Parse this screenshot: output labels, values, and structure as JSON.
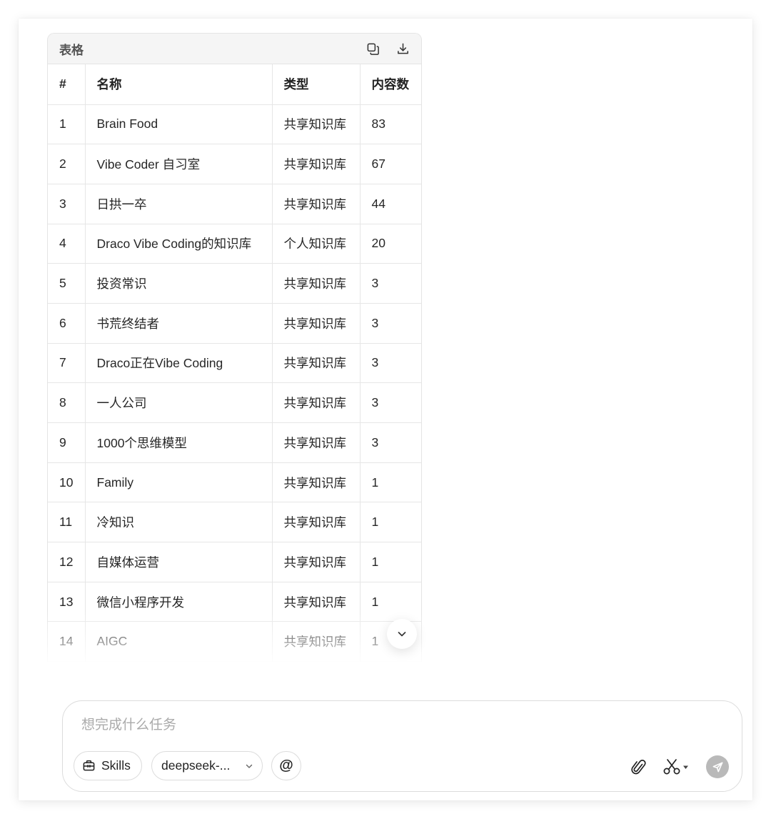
{
  "table_card": {
    "title": "表格",
    "copy_icon": "copy-icon",
    "download_icon": "download-icon",
    "columns": [
      "#",
      "名称",
      "类型",
      "内容数"
    ],
    "rows": [
      [
        "1",
        "Brain Food",
        "共享知识库",
        "83"
      ],
      [
        "2",
        "Vibe Coder 自习室",
        "共享知识库",
        "67"
      ],
      [
        "3",
        "日拱一卒",
        "共享知识库",
        "44"
      ],
      [
        "4",
        "Draco Vibe Coding的知识库",
        "个人知识库",
        "20"
      ],
      [
        "5",
        "投资常识",
        "共享知识库",
        "3"
      ],
      [
        "6",
        "书荒终结者",
        "共享知识库",
        "3"
      ],
      [
        "7",
        "Draco正在Vibe Coding",
        "共享知识库",
        "3"
      ],
      [
        "8",
        "一人公司",
        "共享知识库",
        "3"
      ],
      [
        "9",
        "1000个思维模型",
        "共享知识库",
        "3"
      ],
      [
        "10",
        "Family",
        "共享知识库",
        "1"
      ],
      [
        "11",
        "冷知识",
        "共享知识库",
        "1"
      ],
      [
        "12",
        "自媒体运营",
        "共享知识库",
        "1"
      ],
      [
        "13",
        "微信小程序开发",
        "共享知识库",
        "1"
      ],
      [
        "14",
        "AIGC",
        "共享知识库",
        "1"
      ]
    ]
  },
  "scroll_down_icon": "chevron-down-icon",
  "composer": {
    "placeholder": "想完成什么任务",
    "skills_label": "Skills",
    "skills_icon": "toolbox-icon",
    "model_label": "deepseek-...",
    "at_label": "@",
    "attach_icon": "paperclip-icon",
    "scissors_icon": "scissors-icon",
    "send_icon": "send-icon"
  },
  "colors": {
    "send_button": "#b9b9b9",
    "header_bg": "#f5f5f5",
    "border": "#e4e4e4"
  }
}
